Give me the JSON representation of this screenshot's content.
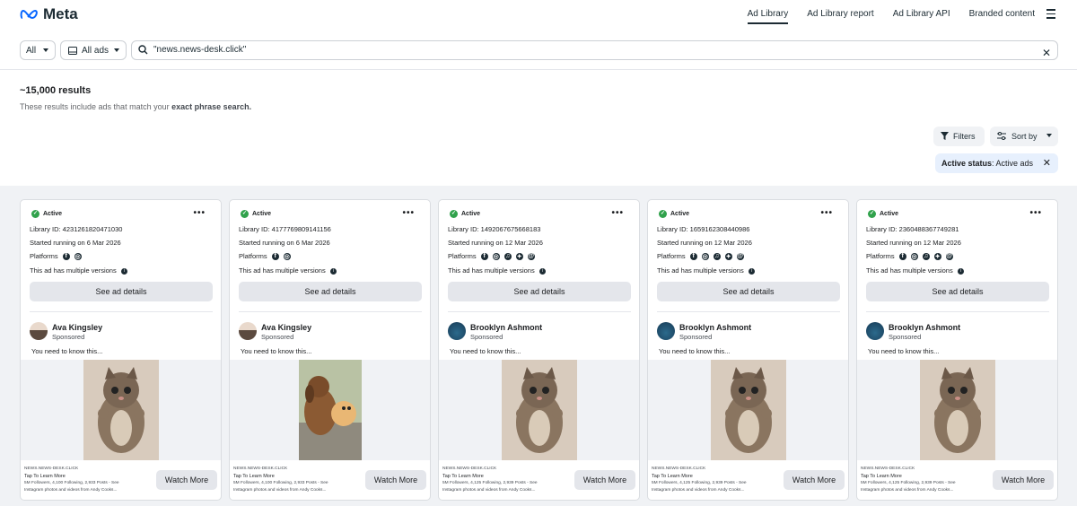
{
  "brand": {
    "logo_text": "Meta"
  },
  "nav": {
    "items": [
      "Ad Library",
      "Ad Library report",
      "Ad Library API",
      "Branded content"
    ]
  },
  "search": {
    "country": "All",
    "ad_type": "All ads",
    "query": "\"news.news-desk.click\""
  },
  "results": {
    "count": "~15,000 results",
    "note_prefix": "These results include ads that match your",
    "note_bold": "exact phrase search."
  },
  "controls": {
    "filters": "Filters",
    "sort": "Sort by"
  },
  "chip": {
    "label": "Active status",
    "value": ": Active ads"
  },
  "cards": [
    {
      "status": "Active",
      "library_id": "Library ID: 4231261820471030",
      "started": "Started running on 6 Mar 2026",
      "platforms_label": "Platforms",
      "platforms": [
        "facebook",
        "instagram"
      ],
      "versions": "This ad has multiple versions",
      "details": "See ad details",
      "advertiser": "Ava Kingsley",
      "sponsored": "Sponsored",
      "body": "You need to know this...",
      "image": "kitten",
      "domain": "NEWS.NEWS-DESK.CLICK",
      "cta_title": "Tap To Learn More",
      "meta_line1": "5M Followers, 4,100 Following, 2,933 Posts - See",
      "meta_line2": "Instagram photos and videos from Andy Cooks...",
      "cta": "Watch More"
    },
    {
      "status": "Active",
      "library_id": "Library ID: 4177769809141156",
      "started": "Started running on 6 Mar 2026",
      "platforms_label": "Platforms",
      "platforms": [
        "facebook",
        "instagram"
      ],
      "versions": "This ad has multiple versions",
      "details": "See ad details",
      "advertiser": "Ava Kingsley",
      "sponsored": "Sponsored",
      "body": "You need to know this...",
      "image": "dogs",
      "domain": "NEWS.NEWS-DESK.CLICK",
      "cta_title": "Tap To Learn More",
      "meta_line1": "5M Followers, 4,100 Following, 2,933 Posts - See",
      "meta_line2": "Instagram photos and videos from Andy Cooks...",
      "cta": "Watch More"
    },
    {
      "status": "Active",
      "library_id": "Library ID: 1492067675668183",
      "started": "Started running on 12 Mar 2026",
      "platforms_label": "Platforms",
      "platforms": [
        "facebook",
        "instagram",
        "audience-network",
        "messenger",
        "threads"
      ],
      "versions": "This ad has multiple versions",
      "details": "See ad details",
      "advertiser": "Brooklyn Ashmont",
      "sponsored": "Sponsored",
      "body": "You need to know this...",
      "image": "kitten",
      "domain": "NEWS.NEWS-DESK.CLICK",
      "cta_title": "Tap To Learn More",
      "meta_line1": "5M Followers, 4,125 Following, 2,939 Posts - See",
      "meta_line2": "Instagram photos and videos from Andy Cooks...",
      "cta": "Watch More"
    },
    {
      "status": "Active",
      "library_id": "Library ID: 1659162308440986",
      "started": "Started running on 12 Mar 2026",
      "platforms_label": "Platforms",
      "platforms": [
        "facebook",
        "instagram",
        "audience-network",
        "messenger",
        "threads"
      ],
      "versions": "This ad has multiple versions",
      "details": "See ad details",
      "advertiser": "Brooklyn Ashmont",
      "sponsored": "Sponsored",
      "body": "You need to know this...",
      "image": "kitten",
      "domain": "NEWS.NEWS-DESK.CLICK",
      "cta_title": "Tap To Learn More",
      "meta_line1": "5M Followers, 4,125 Following, 2,939 Posts - See",
      "meta_line2": "Instagram photos and videos from Andy Cooks...",
      "cta": "Watch More"
    },
    {
      "status": "Active",
      "library_id": "Library ID: 2360488367749281",
      "started": "Started running on 12 Mar 2026",
      "platforms_label": "Platforms",
      "platforms": [
        "facebook",
        "instagram",
        "audience-network",
        "messenger",
        "threads"
      ],
      "versions": "This ad has multiple versions",
      "details": "See ad details",
      "advertiser": "Brooklyn Ashmont",
      "sponsored": "Sponsored",
      "body": "You need to know this...",
      "image": "kitten",
      "domain": "NEWS.NEWS-DESK.CLICK",
      "cta_title": "Tap To Learn More",
      "meta_line1": "5M Followers, 4,125 Following, 2,939 Posts - See",
      "meta_line2": "Instagram photos and videos from Andy Cooks...",
      "cta": "Watch More"
    }
  ],
  "colors": {
    "active": "#31a24c",
    "chip_bg": "#e7f0fd",
    "surface": "#f0f2f5"
  }
}
